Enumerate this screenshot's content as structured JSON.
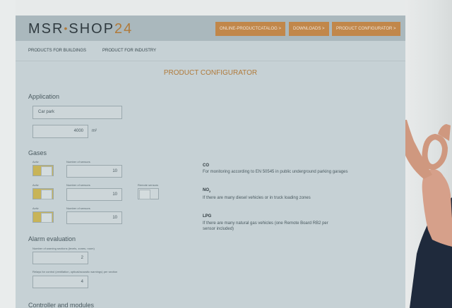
{
  "header": {
    "logo_main": "MSR",
    "logo_sep": "•",
    "logo_shop": "SHOP",
    "logo_num": "24",
    "buttons": [
      "ONLINE-PRODUCTCATALOG >",
      "DOWNLOADS >",
      "PRODUCT CONFIGURATOR >"
    ]
  },
  "subnav": [
    "PRODUCTS FOR BUILDINGS",
    "PRODUCT FOR INDUSTRY"
  ],
  "title": "PRODUCT CONFIGURATOR",
  "application": {
    "heading": "Application",
    "selected": "Car park",
    "area_value": "4000",
    "area_unit": "m²"
  },
  "gases": {
    "heading": "Gases",
    "active_label": "Activ",
    "sensors_label": "Number of sensors",
    "remote_label": "Remote sensors",
    "rows": [
      {
        "value": "10",
        "active": true,
        "name": "CO",
        "sub": "",
        "desc": "For monitoring according to EN 50545 in public underground parking garages"
      },
      {
        "value": "10",
        "active": true,
        "name": "NO",
        "sub": "2",
        "desc": "If there are many diesel vehicles or in truck loading zones"
      },
      {
        "value": "10",
        "active": true,
        "name": "LPG",
        "sub": "",
        "desc": "If there are many natural gas vehicles (one Remote Board RB2 per",
        "desc2": "sensor included)"
      }
    ]
  },
  "alarm": {
    "heading": "Alarm evaluation",
    "sections_label": "Number of warning sections (levels, zones, room)",
    "sections_value": "2",
    "relays_label": "Relays for control (ventilation, optical/acoustic warnings) per section",
    "relays_value": "4"
  },
  "controller": {
    "heading": "Controller and modules"
  },
  "colors": {
    "accent": "#c1874a",
    "toggle_on": "#c8b458"
  }
}
